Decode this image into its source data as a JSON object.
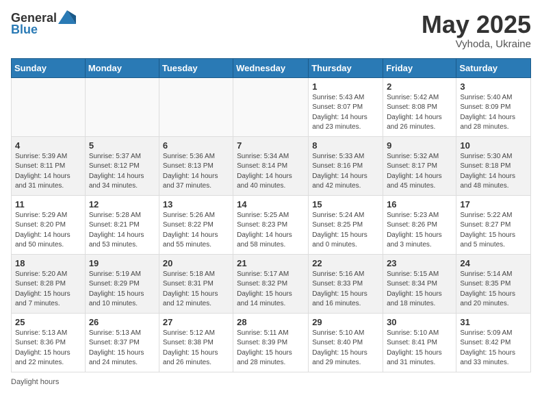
{
  "header": {
    "logo_general": "General",
    "logo_blue": "Blue",
    "title_month": "May 2025",
    "title_location": "Vyhoda, Ukraine"
  },
  "days_of_week": [
    "Sunday",
    "Monday",
    "Tuesday",
    "Wednesday",
    "Thursday",
    "Friday",
    "Saturday"
  ],
  "weeks": [
    {
      "cells": [
        {
          "day": "",
          "info": ""
        },
        {
          "day": "",
          "info": ""
        },
        {
          "day": "",
          "info": ""
        },
        {
          "day": "",
          "info": ""
        },
        {
          "day": "1",
          "info": "Sunrise: 5:43 AM\nSunset: 8:07 PM\nDaylight: 14 hours\nand 23 minutes."
        },
        {
          "day": "2",
          "info": "Sunrise: 5:42 AM\nSunset: 8:08 PM\nDaylight: 14 hours\nand 26 minutes."
        },
        {
          "day": "3",
          "info": "Sunrise: 5:40 AM\nSunset: 8:09 PM\nDaylight: 14 hours\nand 28 minutes."
        }
      ]
    },
    {
      "cells": [
        {
          "day": "4",
          "info": "Sunrise: 5:39 AM\nSunset: 8:11 PM\nDaylight: 14 hours\nand 31 minutes."
        },
        {
          "day": "5",
          "info": "Sunrise: 5:37 AM\nSunset: 8:12 PM\nDaylight: 14 hours\nand 34 minutes."
        },
        {
          "day": "6",
          "info": "Sunrise: 5:36 AM\nSunset: 8:13 PM\nDaylight: 14 hours\nand 37 minutes."
        },
        {
          "day": "7",
          "info": "Sunrise: 5:34 AM\nSunset: 8:14 PM\nDaylight: 14 hours\nand 40 minutes."
        },
        {
          "day": "8",
          "info": "Sunrise: 5:33 AM\nSunset: 8:16 PM\nDaylight: 14 hours\nand 42 minutes."
        },
        {
          "day": "9",
          "info": "Sunrise: 5:32 AM\nSunset: 8:17 PM\nDaylight: 14 hours\nand 45 minutes."
        },
        {
          "day": "10",
          "info": "Sunrise: 5:30 AM\nSunset: 8:18 PM\nDaylight: 14 hours\nand 48 minutes."
        }
      ]
    },
    {
      "cells": [
        {
          "day": "11",
          "info": "Sunrise: 5:29 AM\nSunset: 8:20 PM\nDaylight: 14 hours\nand 50 minutes."
        },
        {
          "day": "12",
          "info": "Sunrise: 5:28 AM\nSunset: 8:21 PM\nDaylight: 14 hours\nand 53 minutes."
        },
        {
          "day": "13",
          "info": "Sunrise: 5:26 AM\nSunset: 8:22 PM\nDaylight: 14 hours\nand 55 minutes."
        },
        {
          "day": "14",
          "info": "Sunrise: 5:25 AM\nSunset: 8:23 PM\nDaylight: 14 hours\nand 58 minutes."
        },
        {
          "day": "15",
          "info": "Sunrise: 5:24 AM\nSunset: 8:25 PM\nDaylight: 15 hours\nand 0 minutes."
        },
        {
          "day": "16",
          "info": "Sunrise: 5:23 AM\nSunset: 8:26 PM\nDaylight: 15 hours\nand 3 minutes."
        },
        {
          "day": "17",
          "info": "Sunrise: 5:22 AM\nSunset: 8:27 PM\nDaylight: 15 hours\nand 5 minutes."
        }
      ]
    },
    {
      "cells": [
        {
          "day": "18",
          "info": "Sunrise: 5:20 AM\nSunset: 8:28 PM\nDaylight: 15 hours\nand 7 minutes."
        },
        {
          "day": "19",
          "info": "Sunrise: 5:19 AM\nSunset: 8:29 PM\nDaylight: 15 hours\nand 10 minutes."
        },
        {
          "day": "20",
          "info": "Sunrise: 5:18 AM\nSunset: 8:31 PM\nDaylight: 15 hours\nand 12 minutes."
        },
        {
          "day": "21",
          "info": "Sunrise: 5:17 AM\nSunset: 8:32 PM\nDaylight: 15 hours\nand 14 minutes."
        },
        {
          "day": "22",
          "info": "Sunrise: 5:16 AM\nSunset: 8:33 PM\nDaylight: 15 hours\nand 16 minutes."
        },
        {
          "day": "23",
          "info": "Sunrise: 5:15 AM\nSunset: 8:34 PM\nDaylight: 15 hours\nand 18 minutes."
        },
        {
          "day": "24",
          "info": "Sunrise: 5:14 AM\nSunset: 8:35 PM\nDaylight: 15 hours\nand 20 minutes."
        }
      ]
    },
    {
      "cells": [
        {
          "day": "25",
          "info": "Sunrise: 5:13 AM\nSunset: 8:36 PM\nDaylight: 15 hours\nand 22 minutes."
        },
        {
          "day": "26",
          "info": "Sunrise: 5:13 AM\nSunset: 8:37 PM\nDaylight: 15 hours\nand 24 minutes."
        },
        {
          "day": "27",
          "info": "Sunrise: 5:12 AM\nSunset: 8:38 PM\nDaylight: 15 hours\nand 26 minutes."
        },
        {
          "day": "28",
          "info": "Sunrise: 5:11 AM\nSunset: 8:39 PM\nDaylight: 15 hours\nand 28 minutes."
        },
        {
          "day": "29",
          "info": "Sunrise: 5:10 AM\nSunset: 8:40 PM\nDaylight: 15 hours\nand 29 minutes."
        },
        {
          "day": "30",
          "info": "Sunrise: 5:10 AM\nSunset: 8:41 PM\nDaylight: 15 hours\nand 31 minutes."
        },
        {
          "day": "31",
          "info": "Sunrise: 5:09 AM\nSunset: 8:42 PM\nDaylight: 15 hours\nand 33 minutes."
        }
      ]
    }
  ],
  "footer": {
    "note": "Daylight hours"
  }
}
